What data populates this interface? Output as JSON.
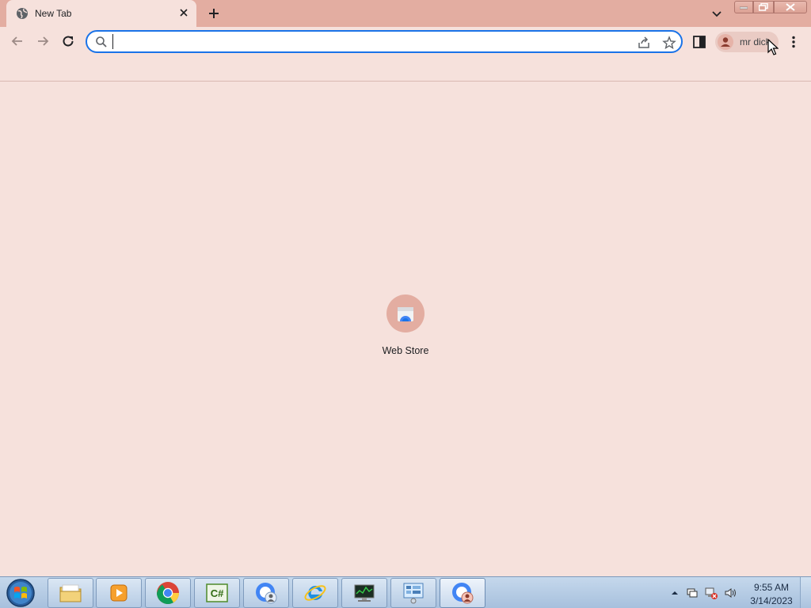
{
  "browser": {
    "tab": {
      "title": "New Tab"
    },
    "omnibox": {
      "value": "",
      "placeholder": ""
    },
    "profile": {
      "name": "mr dick"
    }
  },
  "content": {
    "shortcuts": [
      {
        "label": "Web Store",
        "icon": "web-store-icon"
      }
    ]
  },
  "taskbar": {
    "apps": [
      {
        "name": "file-explorer",
        "icon": "folder-icon"
      },
      {
        "name": "media-player",
        "icon": "media-player-icon"
      },
      {
        "name": "chrome",
        "icon": "chrome-icon"
      },
      {
        "name": "csharp-ide",
        "icon": "csharp-icon"
      },
      {
        "name": "chrome-profile",
        "icon": "chrome-profile-icon"
      },
      {
        "name": "internet-explorer",
        "icon": "ie-icon"
      },
      {
        "name": "task-manager",
        "icon": "monitor-icon"
      },
      {
        "name": "control-panel",
        "icon": "control-panel-icon"
      },
      {
        "name": "chrome-profile-active",
        "icon": "chrome-profile-icon"
      }
    ],
    "clock": {
      "time": "9:55 AM",
      "date": "3/14/2023"
    }
  },
  "colors": {
    "accent": "#1a73e8",
    "tabstrip": "#e3ada1",
    "page_bg": "#f6e1dc"
  }
}
